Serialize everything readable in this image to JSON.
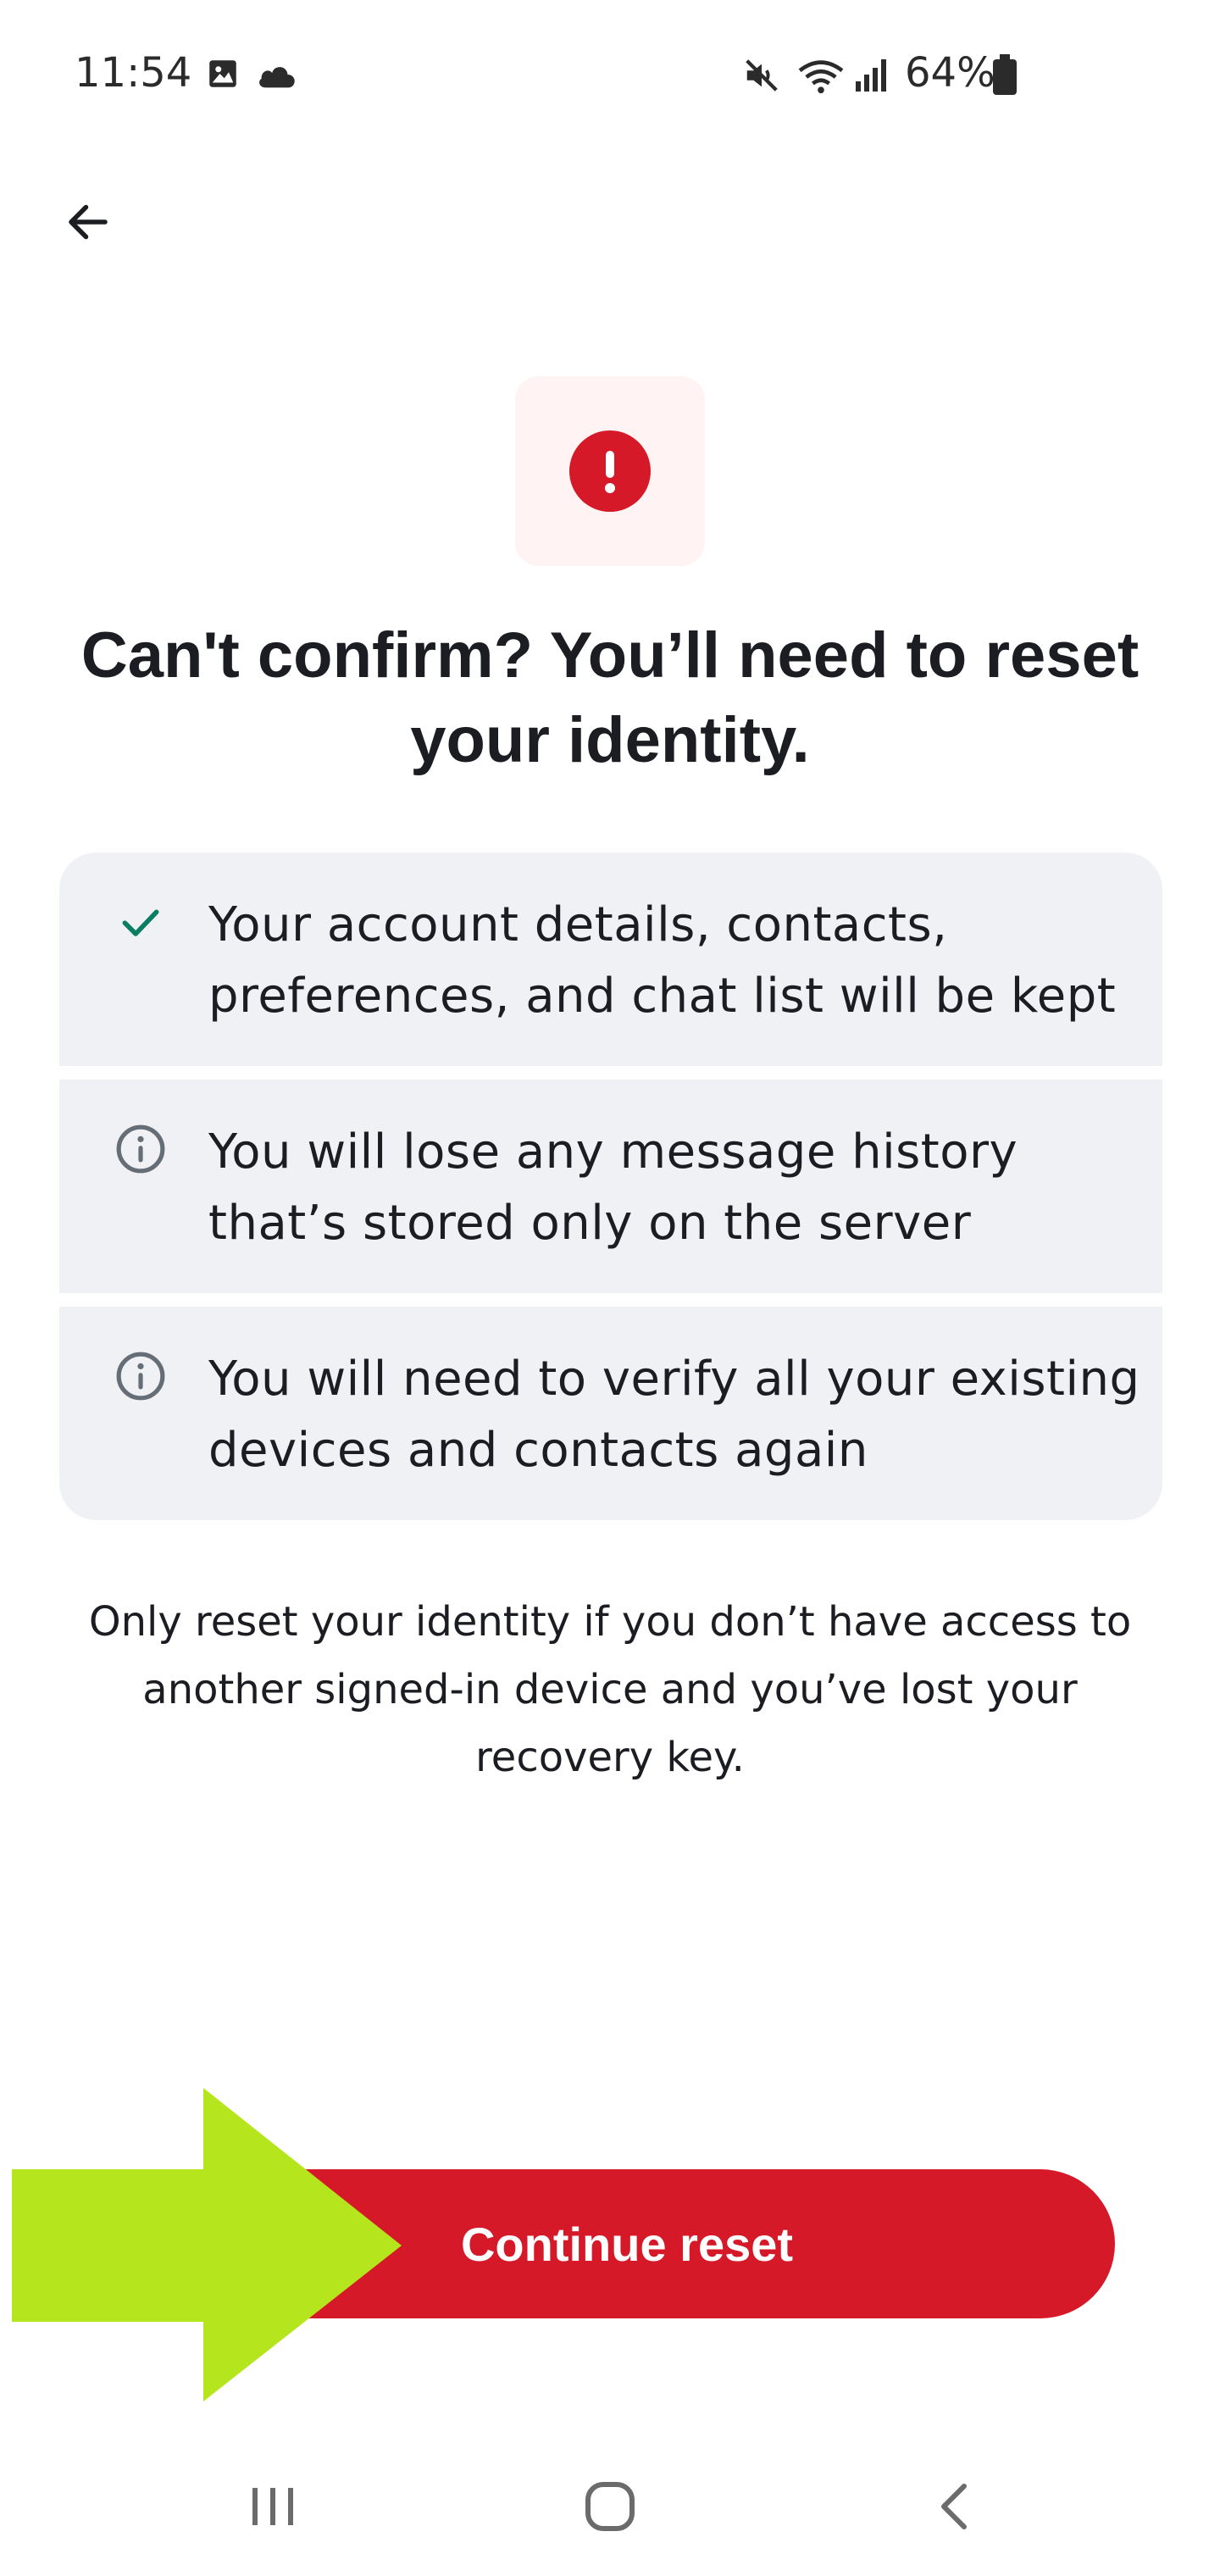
{
  "status_bar": {
    "time": "11:54",
    "battery": "64%",
    "icons": [
      "image-icon",
      "cloud-icon",
      "mute-icon",
      "wifi-icon",
      "signal-icon",
      "battery-icon"
    ]
  },
  "header": {
    "back_icon": "arrow-left-icon"
  },
  "alert": {
    "icon": "exclamation-icon",
    "badge_bg": "#fff4f3",
    "icon_color": "#d51928"
  },
  "title": {
    "line1": "Can't confirm? You’ll need to reset",
    "line2": "your identity."
  },
  "info_items": [
    {
      "icon": "check-icon",
      "line1": "Your account details, contacts,",
      "line2": "preferences, and chat list will be kept"
    },
    {
      "icon": "info-icon",
      "line1": "You will lose any message history",
      "line2": "that’s stored only on the server"
    },
    {
      "icon": "info-icon",
      "line1": "You will need to verify all your existing",
      "line2": "devices and contacts again"
    }
  ],
  "note": {
    "line1": "Only reset your identity if you don’t have access to",
    "line2": "another signed-in device and you’ve lost your",
    "line3": "recovery key."
  },
  "continue_button": {
    "label": "Continue reset",
    "color": "#d51928"
  },
  "annotation": {
    "type": "arrow-pointer",
    "color": "#b5e61d"
  },
  "nav_bar": {
    "recent_icon": "recent-apps-icon",
    "home_icon": "home-icon",
    "back_icon": "back-chevron-icon"
  },
  "colors": {
    "accent_red": "#d51928",
    "check_green": "#0a7d63",
    "info_gray": "#656d77",
    "card_bg": "#f0f1f4"
  }
}
